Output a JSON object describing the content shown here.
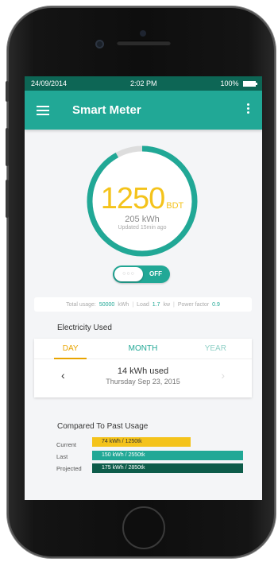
{
  "status": {
    "date": "24/09/2014",
    "time": "2:02 PM",
    "battery": "100%",
    "battery_level": 1.0
  },
  "appbar": {
    "title": "Smart Meter"
  },
  "gauge": {
    "value": "1250",
    "unit": "BDT",
    "kwh": "205 kWh",
    "updated": "Updated 15min ago",
    "progress": 0.92
  },
  "toggle": {
    "state": "OFF",
    "knob_text": "○○○"
  },
  "stats": {
    "total_label": "Total usage:",
    "total_value": "50000",
    "total_unit": "kWh",
    "load_label": "Load",
    "load_value": "1.7",
    "load_unit": "kw",
    "pf_label": "Power factor",
    "pf_value": "0.9"
  },
  "electricity": {
    "title": "Electricity Used",
    "tabs": [
      "DAY",
      "MONTH",
      "YEAR"
    ],
    "used": "14 kWh used",
    "date": "Thursday Sep 23, 2015"
  },
  "comparison": {
    "title": "Compared To Past Usage",
    "rows": [
      {
        "label": "Current",
        "text": "74 kWh / 1250tk",
        "fraction": 0.65,
        "color": "#f4c31b",
        "text_color": "#333333"
      },
      {
        "label": "Last",
        "text": "150 kWh / 2550tk",
        "fraction": 1.0,
        "color": "#21a896",
        "text_color": "#ffffff"
      },
      {
        "label": "Projected",
        "text": "175 kWh / 2850tk",
        "fraction": 1.0,
        "color": "#0d5c4a",
        "text_color": "#ffffff"
      }
    ]
  },
  "colors": {
    "primary": "#21a896",
    "status_bar": "#0d6655",
    "accent": "#f4c31b",
    "track": "#dddddd"
  }
}
